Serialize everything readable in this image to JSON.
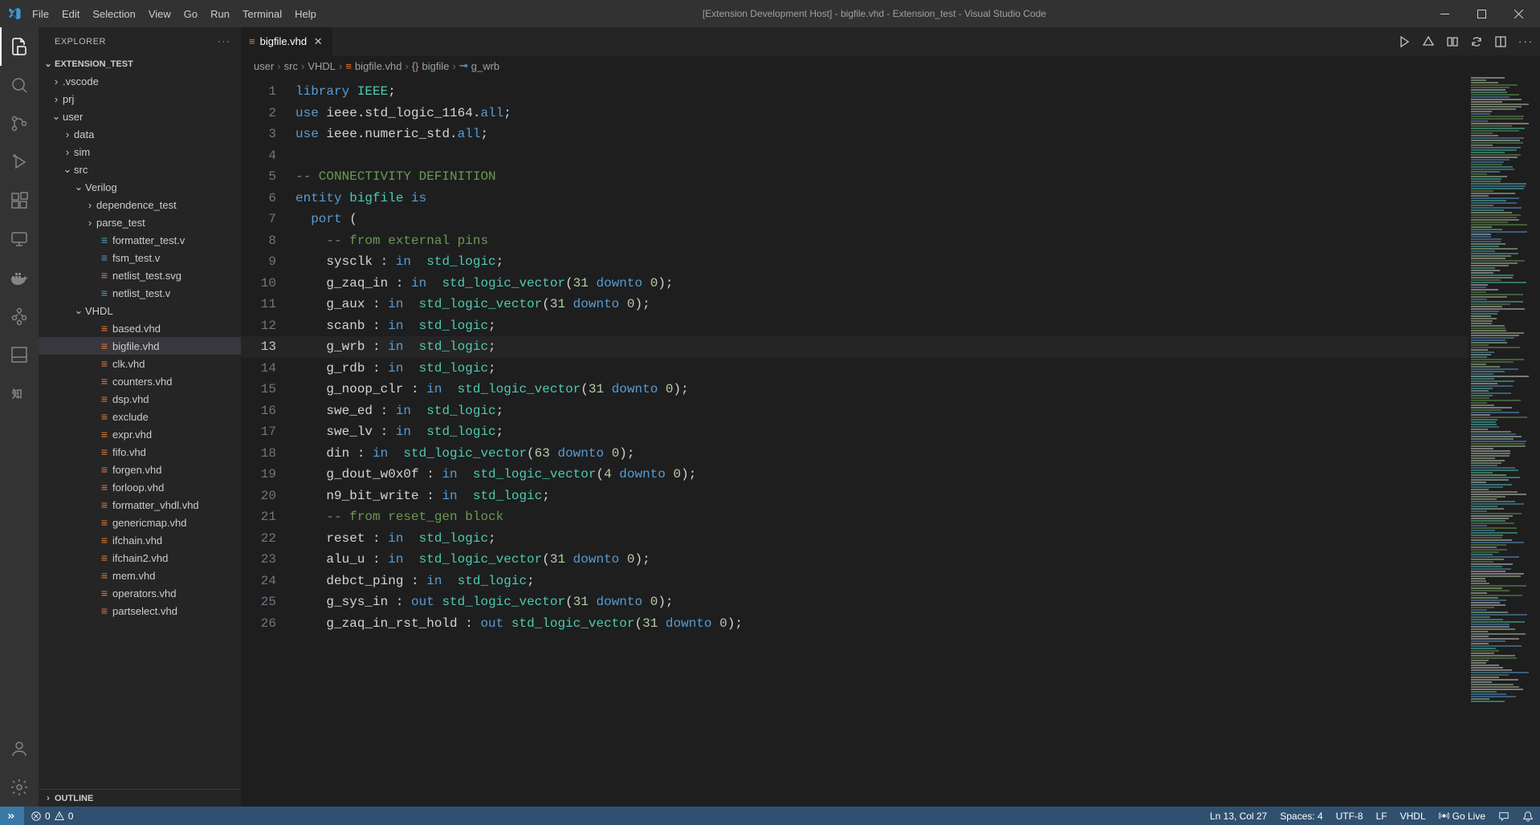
{
  "window_title": "[Extension Development Host] - bigfile.vhd - Extension_test - Visual Studio Code",
  "menu": [
    "File",
    "Edit",
    "Selection",
    "View",
    "Go",
    "Run",
    "Terminal",
    "Help"
  ],
  "explorer_title": "EXPLORER",
  "root_folder": "EXTENSION_TEST",
  "tree": [
    {
      "name": ".vscode",
      "type": "folder",
      "indent": 1,
      "expanded": false
    },
    {
      "name": "prj",
      "type": "folder",
      "indent": 1,
      "expanded": false
    },
    {
      "name": "user",
      "type": "folder",
      "indent": 1,
      "expanded": true
    },
    {
      "name": "data",
      "type": "folder",
      "indent": 2,
      "expanded": false
    },
    {
      "name": "sim",
      "type": "folder",
      "indent": 2,
      "expanded": false
    },
    {
      "name": "src",
      "type": "folder",
      "indent": 2,
      "expanded": true
    },
    {
      "name": "Verilog",
      "type": "folder",
      "indent": 3,
      "expanded": true
    },
    {
      "name": "dependence_test",
      "type": "folder",
      "indent": 4,
      "expanded": false
    },
    {
      "name": "parse_test",
      "type": "folder",
      "indent": 4,
      "expanded": false
    },
    {
      "name": "formatter_test.v",
      "type": "file",
      "indent": 4,
      "icon": "v"
    },
    {
      "name": "fsm_test.v",
      "type": "file",
      "indent": 4,
      "icon": "v"
    },
    {
      "name": "netlist_test.svg",
      "type": "file",
      "indent": 4,
      "icon": "svg"
    },
    {
      "name": "netlist_test.v",
      "type": "file",
      "indent": 4,
      "icon": "v"
    },
    {
      "name": "VHDL",
      "type": "folder",
      "indent": 3,
      "expanded": true
    },
    {
      "name": "based.vhd",
      "type": "file",
      "indent": 4,
      "icon": "vhd"
    },
    {
      "name": "bigfile.vhd",
      "type": "file",
      "indent": 4,
      "icon": "vhd",
      "selected": true
    },
    {
      "name": "clk.vhd",
      "type": "file",
      "indent": 4,
      "icon": "vhd"
    },
    {
      "name": "counters.vhd",
      "type": "file",
      "indent": 4,
      "icon": "vhd"
    },
    {
      "name": "dsp.vhd",
      "type": "file",
      "indent": 4,
      "icon": "vhd"
    },
    {
      "name": "exclude",
      "type": "file",
      "indent": 4,
      "icon": "vhd"
    },
    {
      "name": "expr.vhd",
      "type": "file",
      "indent": 4,
      "icon": "vhd"
    },
    {
      "name": "fifo.vhd",
      "type": "file",
      "indent": 4,
      "icon": "vhd"
    },
    {
      "name": "forgen.vhd",
      "type": "file",
      "indent": 4,
      "icon": "vhd"
    },
    {
      "name": "forloop.vhd",
      "type": "file",
      "indent": 4,
      "icon": "vhd"
    },
    {
      "name": "formatter_vhdl.vhd",
      "type": "file",
      "indent": 4,
      "icon": "vhd"
    },
    {
      "name": "genericmap.vhd",
      "type": "file",
      "indent": 4,
      "icon": "vhd"
    },
    {
      "name": "ifchain.vhd",
      "type": "file",
      "indent": 4,
      "icon": "vhd"
    },
    {
      "name": "ifchain2.vhd",
      "type": "file",
      "indent": 4,
      "icon": "vhd"
    },
    {
      "name": "mem.vhd",
      "type": "file",
      "indent": 4,
      "icon": "vhd"
    },
    {
      "name": "operators.vhd",
      "type": "file",
      "indent": 4,
      "icon": "vhd"
    },
    {
      "name": "partselect.vhd",
      "type": "file",
      "indent": 4,
      "icon": "vhd"
    }
  ],
  "outline": "OUTLINE",
  "tab": {
    "name": "bigfile.vhd"
  },
  "breadcrumb": [
    "user",
    "src",
    "VHDL",
    "bigfile.vhd",
    "bigfile",
    "g_wrb"
  ],
  "code_lines": [
    {
      "n": 1,
      "seg": [
        [
          "kw",
          "library"
        ],
        [
          "punct",
          " "
        ],
        [
          "type",
          "IEEE"
        ],
        [
          "punct",
          ";"
        ]
      ]
    },
    {
      "n": 2,
      "seg": [
        [
          "kw",
          "use"
        ],
        [
          "punct",
          " ieee.std_logic_1164."
        ],
        [
          "kw",
          "all"
        ],
        [
          "punct",
          ";"
        ]
      ]
    },
    {
      "n": 3,
      "seg": [
        [
          "kw",
          "use"
        ],
        [
          "punct",
          " ieee.numeric_std."
        ],
        [
          "kw",
          "all"
        ],
        [
          "punct",
          ";"
        ]
      ]
    },
    {
      "n": 4,
      "seg": []
    },
    {
      "n": 5,
      "seg": [
        [
          "cmt",
          "-- CONNECTIVITY DEFINITION"
        ]
      ]
    },
    {
      "n": 6,
      "seg": [
        [
          "kw",
          "entity"
        ],
        [
          "punct",
          " "
        ],
        [
          "type",
          "bigfile"
        ],
        [
          "punct",
          " "
        ],
        [
          "kw",
          "is"
        ]
      ]
    },
    {
      "n": 7,
      "seg": [
        [
          "punct",
          "  "
        ],
        [
          "kw",
          "port"
        ],
        [
          "punct",
          " ("
        ]
      ]
    },
    {
      "n": 8,
      "seg": [
        [
          "punct",
          "    "
        ],
        [
          "cmt",
          "-- from external pins"
        ]
      ]
    },
    {
      "n": 9,
      "seg": [
        [
          "punct",
          "    sysclk : "
        ],
        [
          "kw",
          "in"
        ],
        [
          "punct",
          "  "
        ],
        [
          "type",
          "std_logic"
        ],
        [
          "punct",
          ";"
        ]
      ]
    },
    {
      "n": 10,
      "seg": [
        [
          "punct",
          "    g_zaq_in : "
        ],
        [
          "kw",
          "in"
        ],
        [
          "punct",
          "  "
        ],
        [
          "type",
          "std_logic_vector"
        ],
        [
          "punct",
          "("
        ],
        [
          "num",
          "31"
        ],
        [
          "punct",
          " "
        ],
        [
          "kw",
          "downto"
        ],
        [
          "punct",
          " "
        ],
        [
          "num",
          "0"
        ],
        [
          "punct",
          ");"
        ]
      ]
    },
    {
      "n": 11,
      "seg": [
        [
          "punct",
          "    g_aux : "
        ],
        [
          "kw",
          "in"
        ],
        [
          "punct",
          "  "
        ],
        [
          "type",
          "std_logic_vector"
        ],
        [
          "punct",
          "("
        ],
        [
          "num",
          "31"
        ],
        [
          "punct",
          " "
        ],
        [
          "kw",
          "downto"
        ],
        [
          "punct",
          " "
        ],
        [
          "num",
          "0"
        ],
        [
          "punct",
          ");"
        ]
      ]
    },
    {
      "n": 12,
      "seg": [
        [
          "punct",
          "    scanb : "
        ],
        [
          "kw",
          "in"
        ],
        [
          "punct",
          "  "
        ],
        [
          "type",
          "std_logic"
        ],
        [
          "punct",
          ";"
        ]
      ]
    },
    {
      "n": 13,
      "current": true,
      "seg": [
        [
          "punct",
          "    g_wrb : "
        ],
        [
          "kw",
          "in"
        ],
        [
          "punct",
          "  "
        ],
        [
          "type",
          "std_logic"
        ],
        [
          "punct",
          ";"
        ]
      ]
    },
    {
      "n": 14,
      "seg": [
        [
          "punct",
          "    g_rdb : "
        ],
        [
          "kw",
          "in"
        ],
        [
          "punct",
          "  "
        ],
        [
          "type",
          "std_logic"
        ],
        [
          "punct",
          ";"
        ]
      ]
    },
    {
      "n": 15,
      "seg": [
        [
          "punct",
          "    g_noop_clr : "
        ],
        [
          "kw",
          "in"
        ],
        [
          "punct",
          "  "
        ],
        [
          "type",
          "std_logic_vector"
        ],
        [
          "punct",
          "("
        ],
        [
          "num",
          "31"
        ],
        [
          "punct",
          " "
        ],
        [
          "kw",
          "downto"
        ],
        [
          "punct",
          " "
        ],
        [
          "num",
          "0"
        ],
        [
          "punct",
          ");"
        ]
      ]
    },
    {
      "n": 16,
      "seg": [
        [
          "punct",
          "    swe_ed : "
        ],
        [
          "kw",
          "in"
        ],
        [
          "punct",
          "  "
        ],
        [
          "type",
          "std_logic"
        ],
        [
          "punct",
          ";"
        ]
      ]
    },
    {
      "n": 17,
      "seg": [
        [
          "punct",
          "    swe_lv : "
        ],
        [
          "kw",
          "in"
        ],
        [
          "punct",
          "  "
        ],
        [
          "type",
          "std_logic"
        ],
        [
          "punct",
          ";"
        ]
      ]
    },
    {
      "n": 18,
      "seg": [
        [
          "punct",
          "    din : "
        ],
        [
          "kw",
          "in"
        ],
        [
          "punct",
          "  "
        ],
        [
          "type",
          "std_logic_vector"
        ],
        [
          "punct",
          "("
        ],
        [
          "num",
          "63"
        ],
        [
          "punct",
          " "
        ],
        [
          "kw",
          "downto"
        ],
        [
          "punct",
          " "
        ],
        [
          "num",
          "0"
        ],
        [
          "punct",
          ");"
        ]
      ]
    },
    {
      "n": 19,
      "seg": [
        [
          "punct",
          "    g_dout_w0x0f : "
        ],
        [
          "kw",
          "in"
        ],
        [
          "punct",
          "  "
        ],
        [
          "type",
          "std_logic_vector"
        ],
        [
          "punct",
          "("
        ],
        [
          "num",
          "4"
        ],
        [
          "punct",
          " "
        ],
        [
          "kw",
          "downto"
        ],
        [
          "punct",
          " "
        ],
        [
          "num",
          "0"
        ],
        [
          "punct",
          ");"
        ]
      ]
    },
    {
      "n": 20,
      "seg": [
        [
          "punct",
          "    n9_bit_write : "
        ],
        [
          "kw",
          "in"
        ],
        [
          "punct",
          "  "
        ],
        [
          "type",
          "std_logic"
        ],
        [
          "punct",
          ";"
        ]
      ]
    },
    {
      "n": 21,
      "seg": [
        [
          "punct",
          "    "
        ],
        [
          "cmt",
          "-- from reset_gen block"
        ]
      ]
    },
    {
      "n": 22,
      "seg": [
        [
          "punct",
          "    reset : "
        ],
        [
          "kw",
          "in"
        ],
        [
          "punct",
          "  "
        ],
        [
          "type",
          "std_logic"
        ],
        [
          "punct",
          ";"
        ]
      ]
    },
    {
      "n": 23,
      "seg": [
        [
          "punct",
          "    alu_u : "
        ],
        [
          "kw",
          "in"
        ],
        [
          "punct",
          "  "
        ],
        [
          "type",
          "std_logic_vector"
        ],
        [
          "punct",
          "("
        ],
        [
          "num",
          "31"
        ],
        [
          "punct",
          " "
        ],
        [
          "kw",
          "downto"
        ],
        [
          "punct",
          " "
        ],
        [
          "num",
          "0"
        ],
        [
          "punct",
          ");"
        ]
      ]
    },
    {
      "n": 24,
      "seg": [
        [
          "punct",
          "    debct_ping : "
        ],
        [
          "kw",
          "in"
        ],
        [
          "punct",
          "  "
        ],
        [
          "type",
          "std_logic"
        ],
        [
          "punct",
          ";"
        ]
      ]
    },
    {
      "n": 25,
      "seg": [
        [
          "punct",
          "    g_sys_in : "
        ],
        [
          "kw",
          "out"
        ],
        [
          "punct",
          " "
        ],
        [
          "type",
          "std_logic_vector"
        ],
        [
          "punct",
          "("
        ],
        [
          "num",
          "31"
        ],
        [
          "punct",
          " "
        ],
        [
          "kw",
          "downto"
        ],
        [
          "punct",
          " "
        ],
        [
          "num",
          "0"
        ],
        [
          "punct",
          ");"
        ]
      ]
    },
    {
      "n": 26,
      "seg": [
        [
          "punct",
          "    g_zaq_in_rst_hold : "
        ],
        [
          "kw",
          "out"
        ],
        [
          "punct",
          " "
        ],
        [
          "type",
          "std_logic_vector"
        ],
        [
          "punct",
          "("
        ],
        [
          "num",
          "31"
        ],
        [
          "punct",
          " "
        ],
        [
          "kw",
          "downto"
        ],
        [
          "punct",
          " "
        ],
        [
          "num",
          "0"
        ],
        [
          "punct",
          ");"
        ]
      ]
    }
  ],
  "status": {
    "errors": "0",
    "warnings": "0",
    "cursor": "Ln 13, Col 27",
    "spaces": "Spaces: 4",
    "encoding": "UTF-8",
    "eol": "LF",
    "lang": "VHDL",
    "golive": "Go Live"
  }
}
